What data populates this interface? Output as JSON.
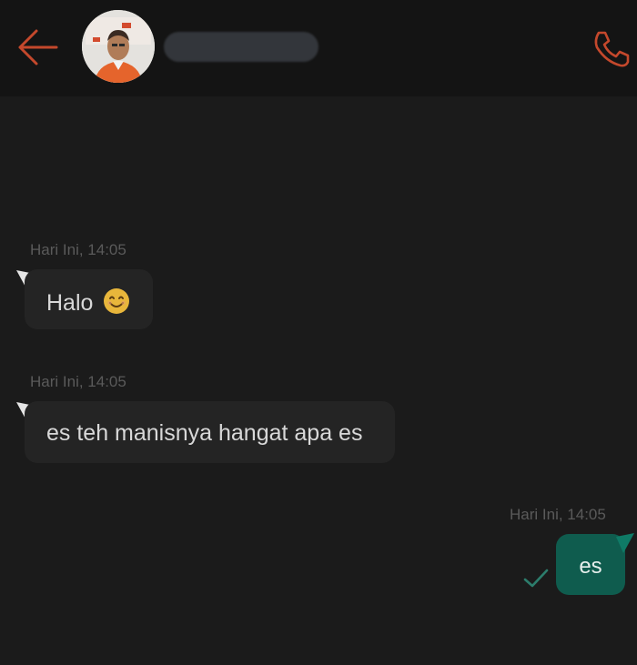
{
  "header": {
    "back_icon": "arrow-left-icon",
    "call_icon": "phone-icon",
    "accent_color": "#c4482c"
  },
  "messages": [
    {
      "direction": "incoming",
      "timestamp": "Hari Ini, 14:05",
      "text": "Halo",
      "emoji": "😊"
    },
    {
      "direction": "incoming",
      "timestamp": "Hari Ini, 14:05",
      "text": "es teh manisnya hangat apa es"
    },
    {
      "direction": "outgoing",
      "timestamp": "Hari Ini, 14:05",
      "text": "es",
      "status_icon": "check-icon"
    }
  ]
}
